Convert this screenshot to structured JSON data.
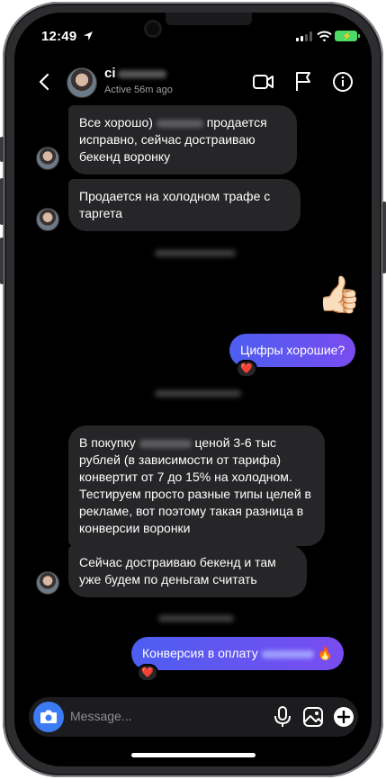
{
  "status_bar": {
    "time": "12:49"
  },
  "header": {
    "name_visible": "ci",
    "active_status": "Active 56m ago"
  },
  "messages": {
    "m1": "Все хорошо)",
    "m1_tail": "продается исправно, сейчас достраиваю бекенд воронку",
    "m2": "Продается на холодном трафе с таргета",
    "thumbs": "👍🏻",
    "out1": "Цифры хорошие?",
    "heart1": "❤️",
    "m3_a": "В покупку",
    "m3_b": "ценой 3-6 тыс рублей (в зависимости от тарифа) конвертит от 7 до 15% на холодном. Тестируем просто разные типы целей в рекламе, вот поэтому такая разница в конверсии воронки",
    "m4": "Сейчас достраиваю бекенд и там уже будем по деньгам считать",
    "out2_a": "Конверсия в оплату",
    "out2_emoji": "🔥",
    "heart2": "❤️"
  },
  "composer": {
    "placeholder": "Message..."
  },
  "icons": [
    "location-arrow-icon",
    "signal-icon",
    "wifi-icon",
    "battery-icon",
    "back-chevron-icon",
    "video-call-icon",
    "flag-icon",
    "info-icon",
    "camera-icon",
    "microphone-icon",
    "gallery-icon",
    "plus-icon"
  ],
  "colors": {
    "outgoing_start": "#4c5ef0",
    "outgoing_end": "#7a4cf0",
    "incoming": "#262628",
    "camera_button": "#3b7cf5",
    "battery": "#4cd964"
  }
}
